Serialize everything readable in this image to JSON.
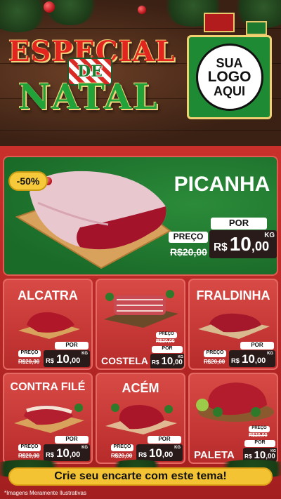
{
  "header": {
    "title_line1": "ESPECIAL",
    "title_de": "DE",
    "title_line2": "NATAL",
    "logo": {
      "line1": "SUA",
      "line2": "LOGO",
      "line3": "AQUI"
    }
  },
  "hero": {
    "product": "PICANHA",
    "discount": "-50%",
    "price_label": "PREÇO",
    "por_label": "POR",
    "old_price": "R$20,00",
    "new_price_main": "10",
    "new_price_cents": ",00",
    "currency": "R$",
    "unit": "KG"
  },
  "cards": [
    {
      "name": "ALCATRA",
      "preco": "PREÇO",
      "por": "POR",
      "old": "R$20,00",
      "currency": "R$",
      "main": "10",
      "cents": ",00",
      "unit": "KG"
    },
    {
      "name": "COSTELA",
      "preco": "PREÇO",
      "por": "POR",
      "old": "R$20,00",
      "currency": "R$",
      "main": "10",
      "cents": ",00",
      "unit": "KG"
    },
    {
      "name": "FRALDINHA",
      "preco": "PREÇO",
      "por": "POR",
      "old": "R$20,00",
      "currency": "R$",
      "main": "10",
      "cents": ",00",
      "unit": "KG"
    },
    {
      "name": "CONTRA FILÉ",
      "preco": "PREÇO",
      "por": "POR",
      "old": "R$20,00",
      "currency": "R$",
      "main": "10",
      "cents": ",00",
      "unit": "KG"
    },
    {
      "name": "ACÉM",
      "preco": "PREÇO",
      "por": "POR",
      "old": "R$20,00",
      "currency": "R$",
      "main": "10",
      "cents": ",00",
      "unit": "KG"
    },
    {
      "name": "PALETA",
      "preco": "PREÇO",
      "por": "POR",
      "old": "R$20,00",
      "currency": "R$",
      "main": "10",
      "cents": ",00",
      "unit": "KG"
    }
  ],
  "cta": "Crie seu encarte com este tema!",
  "disclaimer": "*Imagens Meramente Ilustrativas",
  "colors": {
    "panel_red": "#c9302c",
    "hero_green": "#1a6a28",
    "title_red": "#e2261f",
    "title_green": "#21a33a",
    "gold": "#f3c334"
  }
}
